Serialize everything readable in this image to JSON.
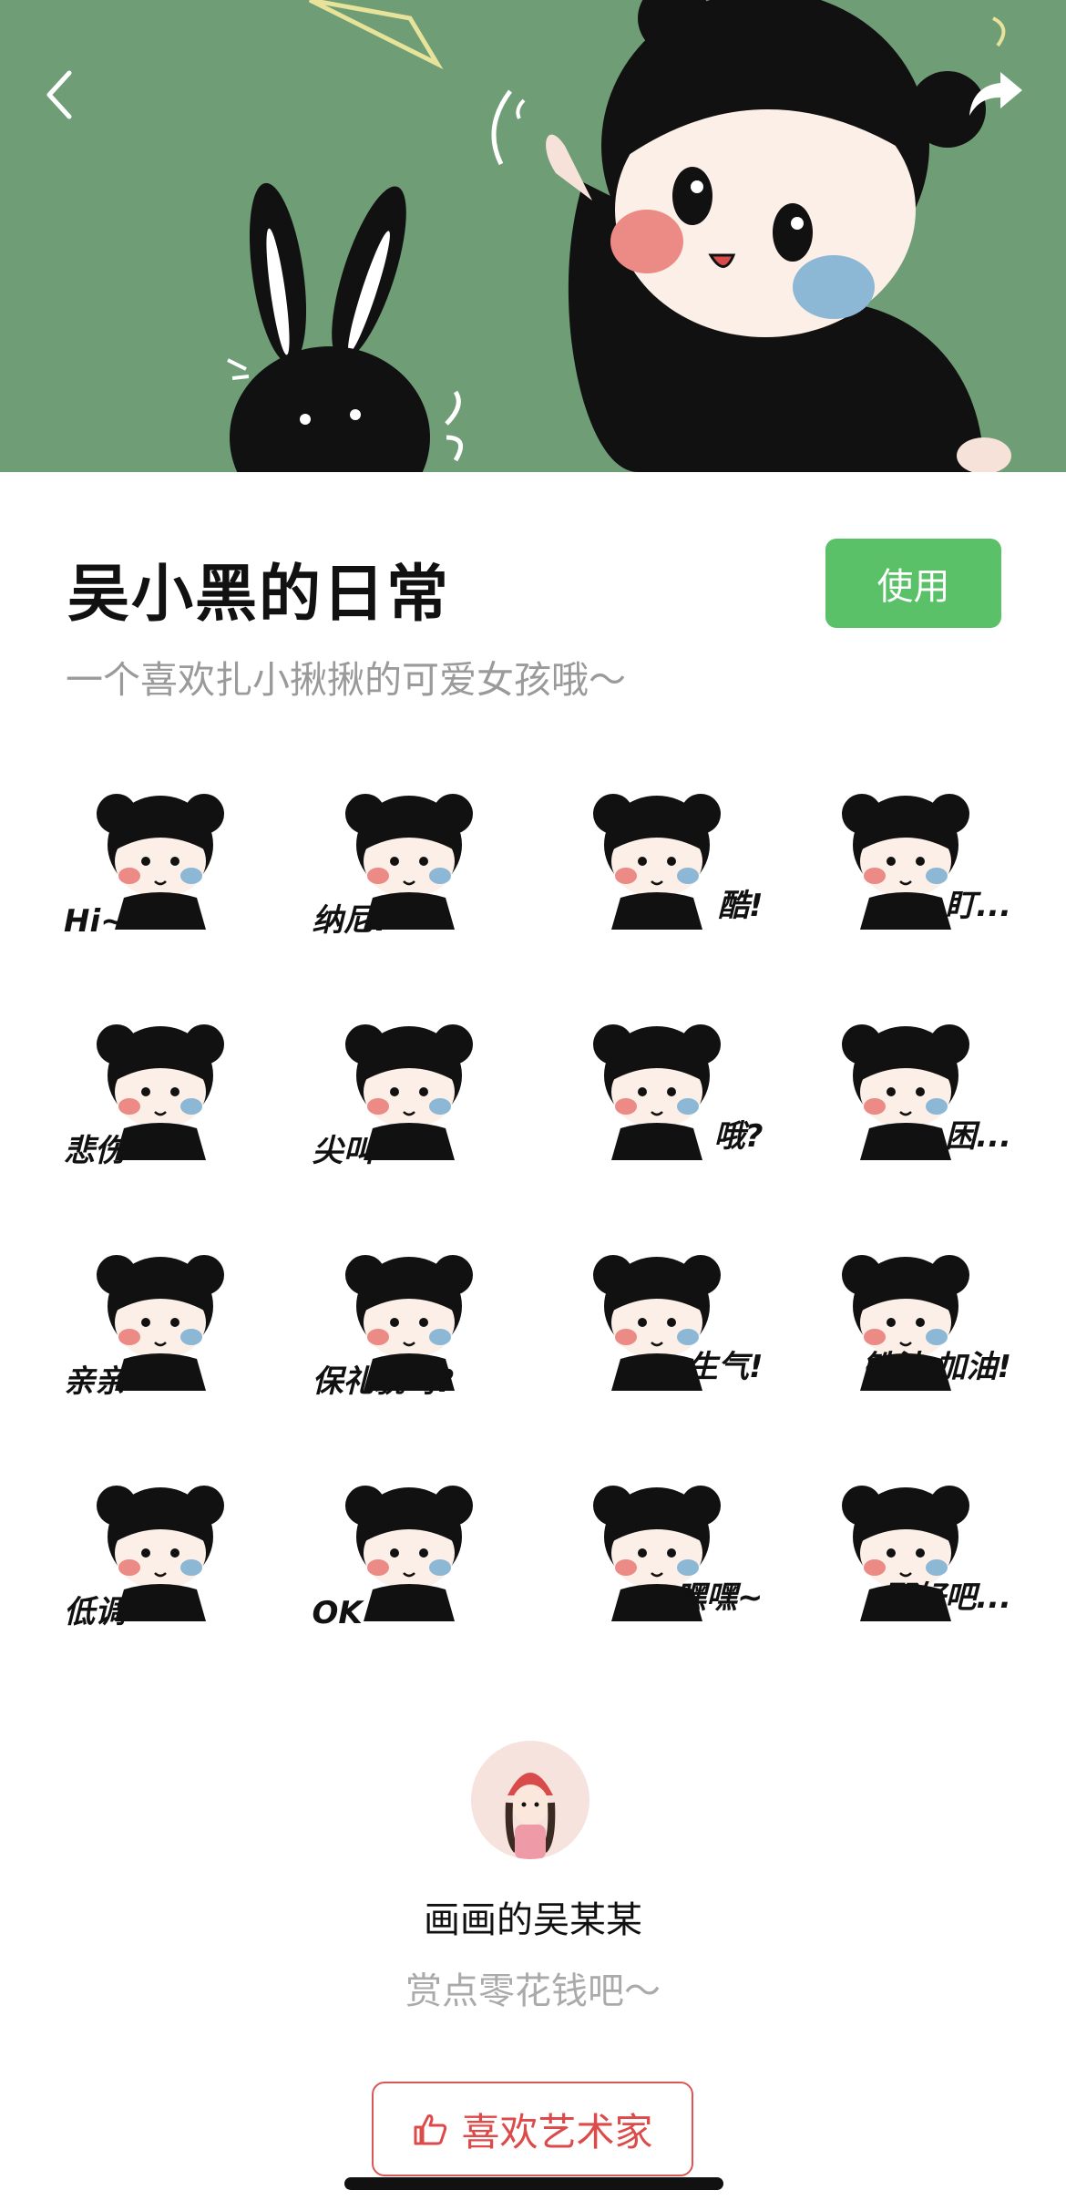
{
  "banner": {
    "back_icon": "chevron-left-icon",
    "share_icon": "share-arrow-icon",
    "background_color": "#6e9d76"
  },
  "pack": {
    "title": "吴小黑的日常",
    "use_label": "使用",
    "description": "一个喜欢扎小揪揪的可爱女孩哦～",
    "accent_color": "#5ac168"
  },
  "stickers": [
    {
      "caption": "Hi~"
    },
    {
      "caption": "纳尼!"
    },
    {
      "caption": "酷!"
    },
    {
      "caption": "盯..."
    },
    {
      "caption": "悲伤"
    },
    {
      "caption": "尖叫"
    },
    {
      "caption": "哦?"
    },
    {
      "caption": "困..."
    },
    {
      "caption": "亲亲~"
    },
    {
      "caption": "保礼貌吗?"
    },
    {
      "caption": "生气!"
    },
    {
      "caption": "铁汁 加油!"
    },
    {
      "caption": "低调"
    },
    {
      "caption": "OK"
    },
    {
      "caption": "嘿嘿~"
    },
    {
      "caption": "那好吧..."
    }
  ],
  "artist": {
    "name": "画画的吴某某",
    "tip_text": "赏点零花钱吧～",
    "like_label": "喜欢艺术家",
    "like_icon": "thumbs-up-icon",
    "like_color": "#dd4a4a"
  }
}
